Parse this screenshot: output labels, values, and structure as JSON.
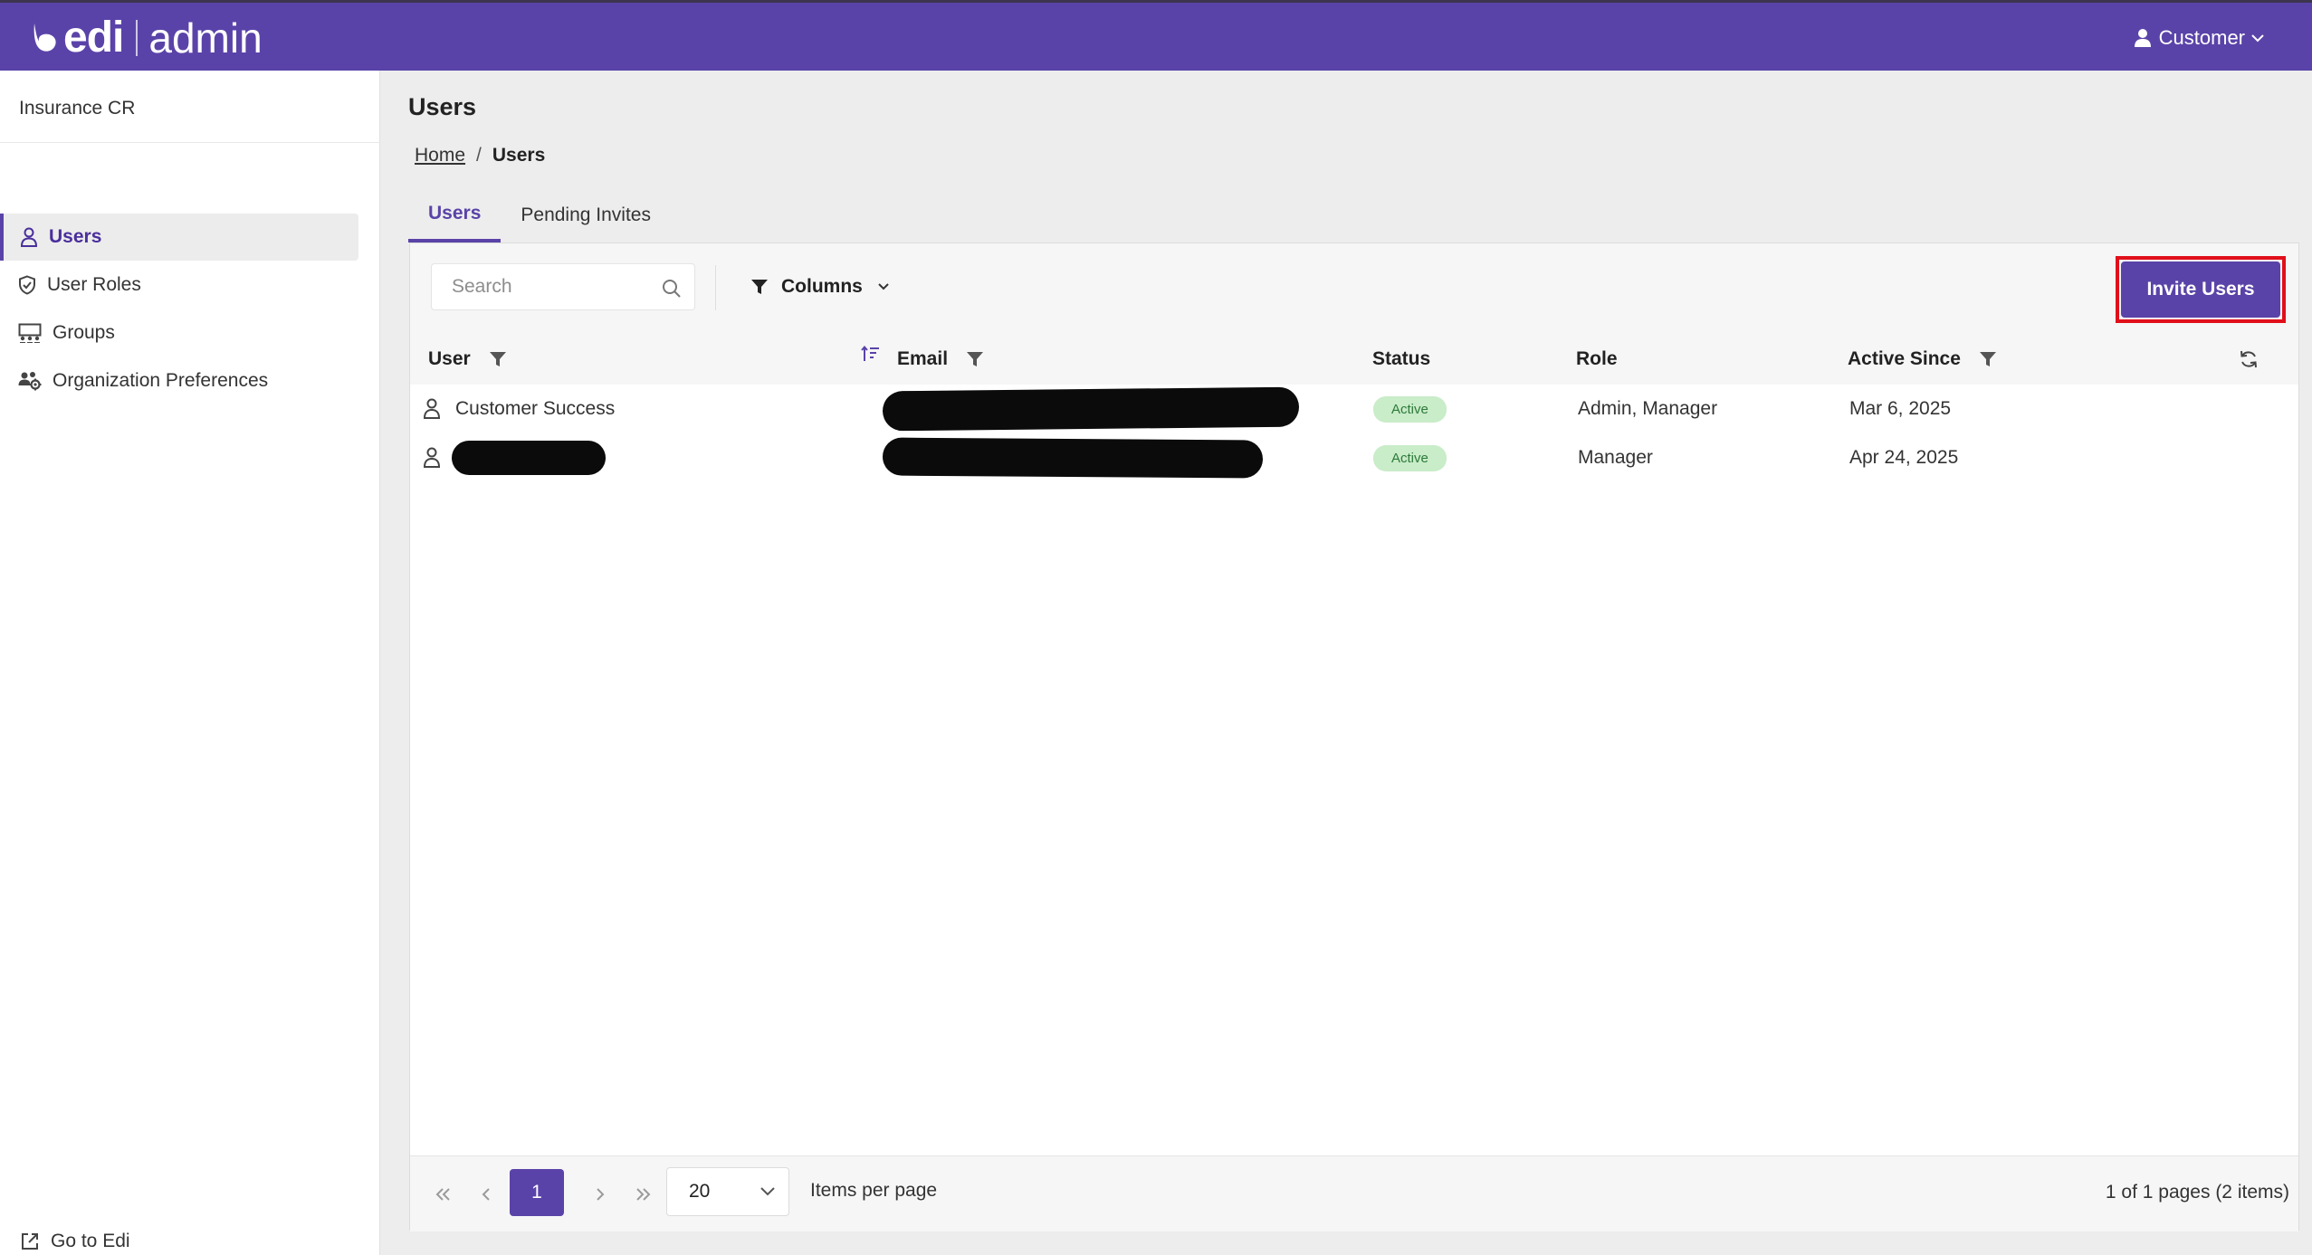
{
  "header": {
    "brand": "edi",
    "product": "admin",
    "account_label": "Customer"
  },
  "sidebar": {
    "org_name": "Insurance CR",
    "items": [
      {
        "label": "Users",
        "icon": "user-icon",
        "active": true
      },
      {
        "label": "User Roles",
        "icon": "shield-check-icon",
        "active": false
      },
      {
        "label": "Groups",
        "icon": "groups-icon",
        "active": false
      },
      {
        "label": "Organization Preferences",
        "icon": "people-settings-icon",
        "active": false
      }
    ],
    "footer_link": "Go to Edi"
  },
  "main": {
    "title": "Users",
    "breadcrumb": {
      "home": "Home",
      "sep": "/",
      "current": "Users"
    },
    "tabs": [
      {
        "label": "Users",
        "active": true
      },
      {
        "label": "Pending Invites",
        "active": false
      }
    ],
    "toolbar": {
      "search_placeholder": "Search",
      "columns_label": "Columns",
      "invite_label": "Invite Users"
    },
    "table": {
      "columns": [
        "User",
        "Email",
        "Status",
        "Role",
        "Active Since"
      ],
      "rows": [
        {
          "user": "Customer Success",
          "email": "[redacted]",
          "status": "Active",
          "role": "Admin, Manager",
          "active_since": "Mar 6, 2025"
        },
        {
          "user": "[redacted]",
          "email": "[redacted]",
          "status": "Active",
          "role": "Manager",
          "active_since": "Apr 24, 2025"
        }
      ]
    },
    "pager": {
      "current_page": "1",
      "page_size": "20",
      "items_per_page_label": "Items per page",
      "summary": "1 of 1 pages (2 items)"
    }
  },
  "colors": {
    "brand_purple": "#5a43a8",
    "highlight_red": "#e0101a",
    "status_active_bg": "#c9ecc9",
    "status_active_text": "#2d7a3a"
  }
}
